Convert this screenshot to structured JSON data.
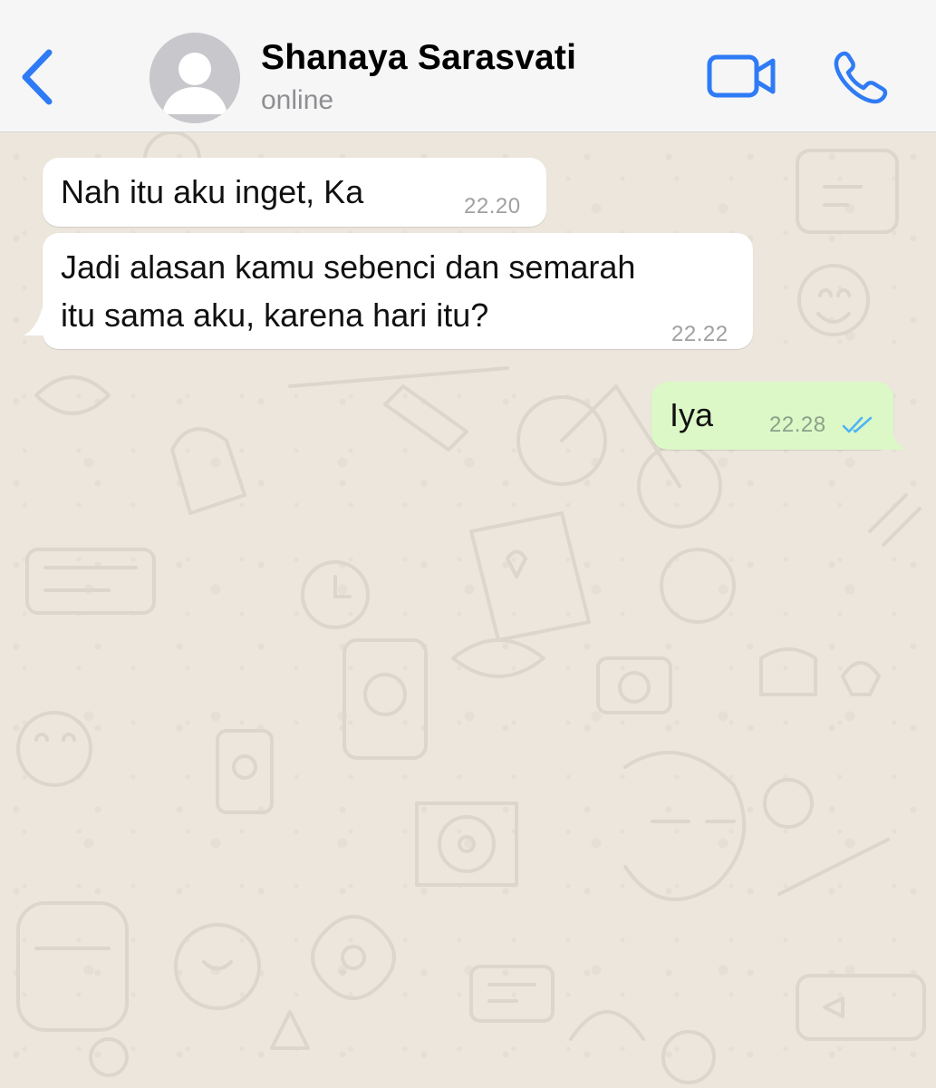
{
  "header": {
    "back_icon": "chevron-left-icon",
    "avatar_icon": "person-silhouette-icon",
    "contact_name": "Shanaya Sarasvati",
    "status": "online",
    "video_icon": "video-camera-icon",
    "call_icon": "phone-icon",
    "accent_color": "#2f7bf5"
  },
  "messages": [
    {
      "direction": "incoming",
      "lines": [
        "Nah itu aku inget, Ka"
      ],
      "time": "22.20"
    },
    {
      "direction": "incoming",
      "lines": [
        "Jadi alasan kamu sebenci dan semarah",
        "itu sama aku, karena hari itu?"
      ],
      "time": "22.22"
    },
    {
      "direction": "outgoing",
      "lines": [
        "Iya"
      ],
      "time": "22.28",
      "status_icon": "double-check-read-icon",
      "status_color": "#4fb3f6"
    }
  ],
  "colors": {
    "incoming_bubble": "#ffffff",
    "outgoing_bubble": "#dcf8c6",
    "chat_background": "#ece6dc"
  }
}
